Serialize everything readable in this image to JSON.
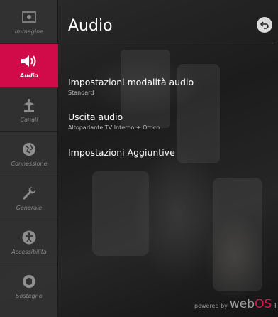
{
  "header": {
    "title": "Audio"
  },
  "sidebar": {
    "items": [
      {
        "label": "Immagine",
        "icon": "picture-icon",
        "active": false
      },
      {
        "label": "Audio",
        "icon": "speaker-icon",
        "active": true
      },
      {
        "label": "Canali",
        "icon": "antenna-icon",
        "active": false
      },
      {
        "label": "Connessione",
        "icon": "network-globe-icon",
        "active": false
      },
      {
        "label": "Generale",
        "icon": "wrench-icon",
        "active": false
      },
      {
        "label": "Accessibilità",
        "icon": "accessibility-icon",
        "active": false
      },
      {
        "label": "Sostegno",
        "icon": "support-headset-icon",
        "active": false
      }
    ]
  },
  "menu": {
    "items": [
      {
        "label": "Impostazioni modalità audio",
        "value": "Standard"
      },
      {
        "label": "Uscita audio",
        "value": "Altoparlante TV Interno + Ottico"
      },
      {
        "label": "Impostazioni Aggiuntive",
        "value": ""
      }
    ]
  },
  "branding": {
    "powered": "powered by",
    "web": "web",
    "os": "OS",
    "tv": "TV"
  },
  "colors": {
    "accent": "#d10a4a",
    "sidebar_bg": "#323232",
    "brand_os": "#e0164f"
  }
}
